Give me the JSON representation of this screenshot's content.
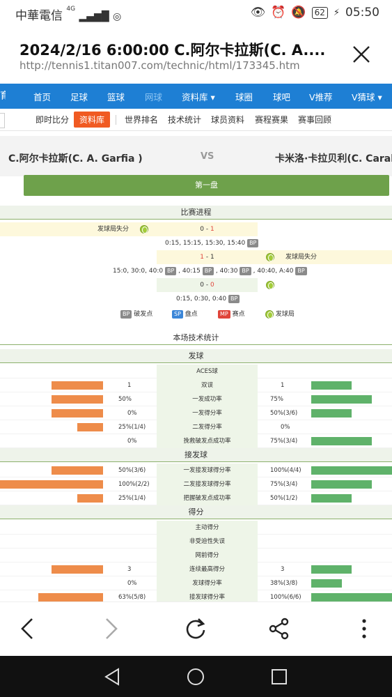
{
  "status_bar": {
    "carrier": "中華電信",
    "network": "4G",
    "battery": "62",
    "time": "05:50"
  },
  "title_bar": {
    "title": "2024/2/16 6:00:00 C.阿尔卡拉斯(C. A....",
    "url": "http://tennis1.titan007.com/technic/html/173345.htm"
  },
  "nav_primary": [
    "首页",
    "足球",
    "篮球",
    "网球",
    "资料库 ▾",
    "球圈",
    "球吧",
    "V推荐",
    "V猜球 ▾"
  ],
  "nav_secondary": [
    "即时比分",
    "资料库",
    "世界排名",
    "技术统计",
    "球员资料",
    "赛程赛果",
    "赛事回顾"
  ],
  "match": {
    "player1": "C.阿尔卡拉斯(C. A. Garfia )",
    "vs": "VS",
    "player2": "卡米洛·卡拉贝利(C. Carab",
    "set_label": "第一盘"
  },
  "progress": {
    "title": "比赛进程",
    "lost_serve": "发球局失分",
    "score1": [
      "0",
      "-",
      "1"
    ],
    "points1": "0:15, 15:15, 15:30, 15:40",
    "score2": [
      "1",
      "-",
      "1"
    ],
    "points2": [
      "15:0, 30:0, 40:0",
      ", 40:15",
      ", 40:30",
      ", 40:40, A:40"
    ],
    "score3": [
      "0",
      "-",
      "0"
    ],
    "points3": "0:15, 0:30, 0:40",
    "legend": {
      "bp": "BP",
      "bp_label": "破发点",
      "sp": "SP",
      "sp_label": "盘点",
      "mp": "MP",
      "mp_label": "赛点",
      "serve_label": "发球局"
    }
  },
  "stats": {
    "title": "本场技术统计",
    "serve_title": "发球",
    "serve": [
      {
        "label": "ACES球",
        "left": "",
        "right": "",
        "lbar": 0,
        "rbar": 0
      },
      {
        "label": "双误",
        "left": "1",
        "right": "1",
        "lbar": 0.5,
        "rbar": 0.5
      },
      {
        "label": "一发成功率",
        "left": "50%",
        "right": "75%",
        "lbar": 0.5,
        "rbar": 0.75
      },
      {
        "label": "一发得分率",
        "left": "0%",
        "right": "50%(3/6)",
        "lbar": 0.5,
        "rbar": 0.5
      },
      {
        "label": "二发得分率",
        "left": "25%(1/4)",
        "right": "0%",
        "lbar": 0.25,
        "rbar": 0
      },
      {
        "label": "挽救破发点成功率",
        "left": "0%",
        "right": "75%(3/4)",
        "lbar": 0,
        "rbar": 0.75
      }
    ],
    "return_title": "接发球",
    "return": [
      {
        "label": "一发接发球得分率",
        "left": "50%(3/6)",
        "right": "100%(4/4)",
        "lbar": 0.5,
        "rbar": 1.0
      },
      {
        "label": "二发接发球得分率",
        "left": "100%(2/2)",
        "right": "75%(3/4)",
        "lbar": 1.0,
        "rbar": 0.75
      },
      {
        "label": "把握破发点成功率",
        "left": "25%(1/4)",
        "right": "50%(1/2)",
        "lbar": 0.25,
        "rbar": 0.5
      }
    ],
    "points_title": "得分",
    "points": [
      {
        "label": "主动得分",
        "left": "",
        "right": "",
        "lbar": 0,
        "rbar": 0
      },
      {
        "label": "非受迫性失误",
        "left": "",
        "right": "",
        "lbar": 0,
        "rbar": 0
      },
      {
        "label": "网前得分",
        "left": "",
        "right": "",
        "lbar": 0,
        "rbar": 0
      },
      {
        "label": "连续最高得分",
        "left": "3",
        "right": "3",
        "lbar": 0.5,
        "rbar": 0.5
      },
      {
        "label": "发球得分率",
        "left": "0%",
        "right": "38%(3/8)",
        "lbar": 0,
        "rbar": 0.38
      },
      {
        "label": "接发球得分率",
        "left": "63%(5/8)",
        "right": "100%(6/6)",
        "lbar": 0.63,
        "rbar": 1.0
      }
    ]
  },
  "colors": {
    "nav": "#1e7fd4",
    "accent": "#f05a22",
    "set_bar": "#6ea14b",
    "left_bar": "#ee8c4a",
    "right_bar": "#5fb26a"
  }
}
